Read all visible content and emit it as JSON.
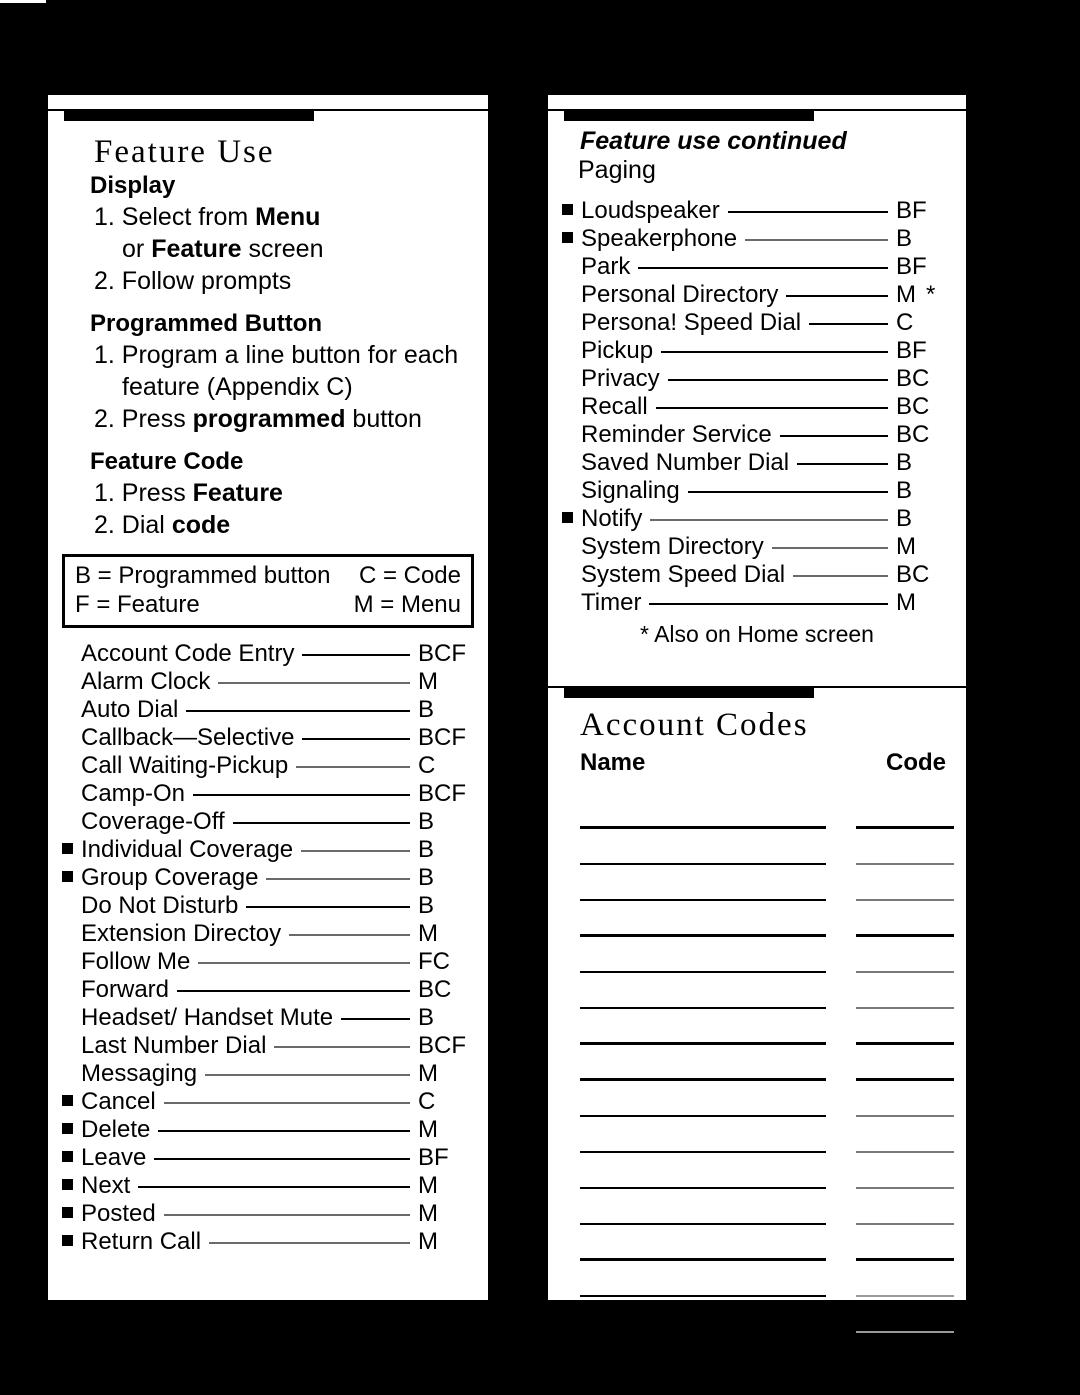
{
  "document": {
    "title": "Telephone Feature Reference Card",
    "background_color": "#000000",
    "card_color": "#ffffff"
  },
  "left_card": {
    "heading": "Feature Use",
    "sections": [
      {
        "name": "display",
        "title": "Display",
        "steps": [
          {
            "text_plain_1": "1. Select from ",
            "bold": "Menu",
            "text_plain_2": ""
          },
          {
            "indent": true,
            "text_plain_1": "or ",
            "bold": "Feature",
            "text_plain_2": " screen"
          },
          {
            "text_plain_1": "2. Follow prompts",
            "bold": "",
            "text_plain_2": ""
          }
        ]
      },
      {
        "name": "programmed-button",
        "title": "Programmed Button",
        "steps": [
          {
            "text_plain_1": "1. Program a line button for each",
            "bold": "",
            "text_plain_2": ""
          },
          {
            "indent": true,
            "text_plain_1": "feature (Appendix C)",
            "bold": "",
            "text_plain_2": ""
          },
          {
            "text_plain_1": "2. Press ",
            "bold": "programmed",
            "text_plain_2": " button"
          }
        ]
      },
      {
        "name": "feature-code",
        "title": "Feature Code",
        "steps": [
          {
            "text_plain_1": "1. Press ",
            "bold": "Feature",
            "text_plain_2": ""
          },
          {
            "text_plain_1": "2. Dial ",
            "bold": "code",
            "text_plain_2": ""
          }
        ]
      }
    ],
    "legend": [
      {
        "left": "B = Programmed button",
        "right": "C = Code"
      },
      {
        "left": "F = Feature",
        "right": "M = Menu"
      }
    ],
    "features": [
      {
        "label": "Account Code Entry",
        "code": "BCF",
        "bullet": false,
        "leader": "normal"
      },
      {
        "label": "Alarm Clock",
        "code": "M",
        "bullet": false,
        "leader": "thin"
      },
      {
        "label": "Auto Dial",
        "code": "B",
        "bullet": false,
        "leader": "normal"
      },
      {
        "label": "Callback—Selective",
        "code": "BCF",
        "bullet": false,
        "leader": "normal"
      },
      {
        "label": "Call Waiting-Pickup",
        "code": "C",
        "bullet": false,
        "leader": "thin"
      },
      {
        "label": "Camp-On",
        "code": "BCF",
        "bullet": false,
        "leader": "normal"
      },
      {
        "label": "Coverage-Off",
        "code": "B",
        "bullet": false,
        "leader": "normal"
      },
      {
        "label": "Individual Coverage",
        "code": "B",
        "bullet": true,
        "leader": "thin"
      },
      {
        "label": "Group Coverage",
        "code": "B",
        "bullet": true,
        "leader": "thin"
      },
      {
        "label": "Do Not Disturb",
        "code": "B",
        "bullet": false,
        "leader": "normal"
      },
      {
        "label": "Extension Directoy",
        "code": "M",
        "bullet": false,
        "leader": "thin"
      },
      {
        "label": "Follow Me",
        "code": "FC",
        "bullet": false,
        "leader": "thin"
      },
      {
        "label": "Forward",
        "code": "BC",
        "bullet": false,
        "leader": "normal"
      },
      {
        "label": "Headset/ Handset Mute",
        "code": "B",
        "bullet": false,
        "leader": "normal"
      },
      {
        "label": "Last Number Dial",
        "code": "BCF",
        "bullet": false,
        "leader": "thin"
      },
      {
        "label": "Messaging",
        "code": "M",
        "bullet": false,
        "leader": "thin"
      },
      {
        "label": "Cancel",
        "code": "C",
        "bullet": true,
        "leader": "thin"
      },
      {
        "label": "Delete",
        "code": "M",
        "bullet": true,
        "leader": "normal"
      },
      {
        "label": "Leave",
        "code": "BF",
        "bullet": true,
        "leader": "normal"
      },
      {
        "label": "Next",
        "code": "M",
        "bullet": true,
        "leader": "normal"
      },
      {
        "label": "Posted",
        "code": "M",
        "bullet": true,
        "leader": "thin"
      },
      {
        "label": "Return Call",
        "code": "M",
        "bullet": true,
        "leader": "thin"
      }
    ]
  },
  "right_card_top": {
    "heading": "Feature use continued",
    "group_label": "Paging",
    "features": [
      {
        "label": "Loudspeaker",
        "code": "BF",
        "bullet": true,
        "leader": "normal",
        "star": ""
      },
      {
        "label": "Speakerphone",
        "code": "B",
        "bullet": true,
        "leader": "thin",
        "star": ""
      },
      {
        "label": "Park",
        "code": "BF",
        "bullet": false,
        "leader": "normal",
        "star": ""
      },
      {
        "label": "Personal Directory",
        "code": "M",
        "bullet": false,
        "leader": "normal",
        "star": "*"
      },
      {
        "label": "Persona! Speed Dial",
        "code": "C",
        "bullet": false,
        "leader": "normal",
        "star": ""
      },
      {
        "label": "Pickup",
        "code": "BF",
        "bullet": false,
        "leader": "normal",
        "star": ""
      },
      {
        "label": "Privacy",
        "code": "BC",
        "bullet": false,
        "leader": "normal",
        "star": ""
      },
      {
        "label": "Recall",
        "code": "BC",
        "bullet": false,
        "leader": "normal",
        "star": ""
      },
      {
        "label": "Reminder Service",
        "code": "BC",
        "bullet": false,
        "leader": "normal",
        "star": ""
      },
      {
        "label": "Saved Number Dial",
        "code": "B",
        "bullet": false,
        "leader": "normal",
        "star": ""
      },
      {
        "label": "Signaling",
        "code": "B",
        "bullet": false,
        "leader": "normal",
        "star": ""
      },
      {
        "label": "Notify",
        "code": "B",
        "bullet": true,
        "leader": "thin",
        "star": ""
      },
      {
        "label": "System Directory",
        "code": "M",
        "bullet": false,
        "leader": "thin",
        "star": ""
      },
      {
        "label": "System Speed Dial",
        "code": "BC",
        "bullet": false,
        "leader": "thin",
        "star": ""
      },
      {
        "label": "Timer",
        "code": "M",
        "bullet": false,
        "leader": "normal",
        "star": ""
      }
    ],
    "footnote": "* Also on Home screen"
  },
  "right_card_bottom": {
    "heading": "Account Codes",
    "columns": {
      "name": "Name",
      "code": "Code"
    },
    "rows": [
      {
        "name": "",
        "code": "",
        "name_weight": "bold",
        "code_weight": "bold"
      },
      {
        "name": "",
        "code": "",
        "name_weight": "bold",
        "code_weight": "thin"
      },
      {
        "name": "",
        "code": "",
        "name_weight": "bold",
        "code_weight": "thin"
      },
      {
        "name": "",
        "code": "",
        "name_weight": "bold",
        "code_weight": "bold"
      },
      {
        "name": "",
        "code": "",
        "name_weight": "bold",
        "code_weight": "thin"
      },
      {
        "name": "",
        "code": "",
        "name_weight": "bold",
        "code_weight": "thin"
      },
      {
        "name": "",
        "code": "",
        "name_weight": "bold",
        "code_weight": "bold"
      },
      {
        "name": "",
        "code": "",
        "name_weight": "bold",
        "code_weight": "bold"
      },
      {
        "name": "",
        "code": "",
        "name_weight": "bold",
        "code_weight": "thin"
      },
      {
        "name": "",
        "code": "",
        "name_weight": "bold",
        "code_weight": "thin"
      },
      {
        "name": "",
        "code": "",
        "name_weight": "bold",
        "code_weight": "thin"
      },
      {
        "name": "",
        "code": "",
        "name_weight": "bold",
        "code_weight": "thin"
      },
      {
        "name": "",
        "code": "",
        "name_weight": "bold",
        "code_weight": "bold"
      },
      {
        "name": "",
        "code": "",
        "name_weight": "thin",
        "code_weight": "thin"
      },
      {
        "name": "",
        "code": "",
        "name_weight": "thin",
        "code_weight": "thin"
      }
    ]
  }
}
